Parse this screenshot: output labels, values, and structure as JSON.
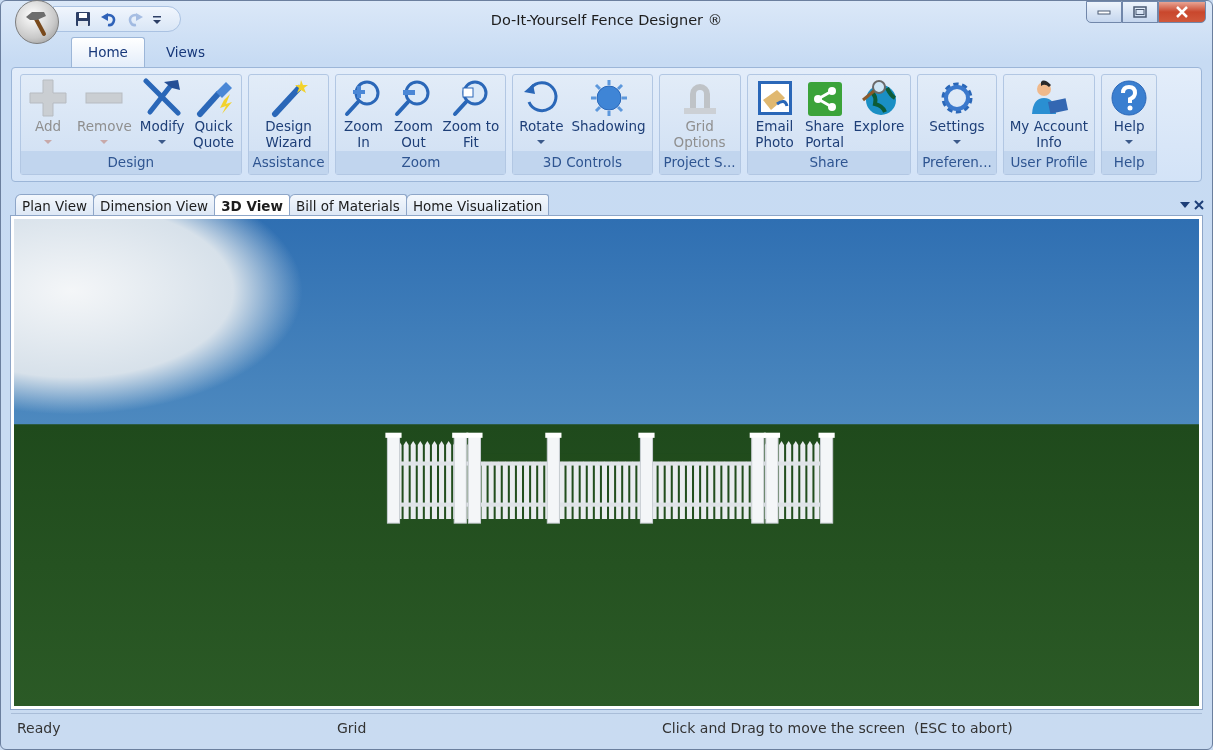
{
  "window": {
    "title": "Do-It-Yourself Fence Designer ®"
  },
  "quick_access": [
    {
      "kind": "save",
      "disabled": false
    },
    {
      "kind": "undo",
      "disabled": false
    },
    {
      "kind": "redo",
      "disabled": true
    },
    {
      "kind": "customize",
      "disabled": false
    }
  ],
  "ribbon_tabs": [
    {
      "label": "Home",
      "selected": true
    },
    {
      "label": "Views",
      "selected": false
    }
  ],
  "ribbon_groups": [
    {
      "label": "Design",
      "buttons": [
        {
          "label": "Add",
          "disabled": true,
          "has_menu": true
        },
        {
          "label": "Remove",
          "disabled": true,
          "has_menu": true
        },
        {
          "label": "Modify",
          "disabled": false,
          "has_menu": true
        },
        {
          "label": "Quick\nQuote",
          "disabled": false,
          "has_menu": false
        }
      ]
    },
    {
      "label": "Assistance",
      "buttons": [
        {
          "label": "Design\nWizard",
          "disabled": false,
          "has_menu": false
        }
      ]
    },
    {
      "label": "Zoom",
      "buttons": [
        {
          "label": "Zoom\nIn",
          "disabled": false,
          "has_menu": false
        },
        {
          "label": "Zoom\nOut",
          "disabled": false,
          "has_menu": false
        },
        {
          "label": "Zoom to\nFit",
          "disabled": false,
          "has_menu": false
        }
      ]
    },
    {
      "label": "3D Controls",
      "buttons": [
        {
          "label": "Rotate",
          "disabled": false,
          "has_menu": true
        },
        {
          "label": "Shadowing",
          "disabled": false,
          "has_menu": false
        }
      ]
    },
    {
      "label": "Project S...",
      "buttons": [
        {
          "label": "Grid\nOptions",
          "disabled": true,
          "has_menu": false
        }
      ]
    },
    {
      "label": "Share",
      "buttons": [
        {
          "label": "Email\nPhoto",
          "disabled": false,
          "has_menu": false
        },
        {
          "label": "Share\nPortal",
          "disabled": false,
          "has_menu": false
        },
        {
          "label": "Explore",
          "disabled": false,
          "has_menu": false
        }
      ]
    },
    {
      "label": "Preferen...",
      "buttons": [
        {
          "label": "Settings",
          "disabled": false,
          "has_menu": true
        }
      ]
    },
    {
      "label": "User Profile",
      "buttons": [
        {
          "label": "My Account\nInfo",
          "disabled": false,
          "has_menu": false
        }
      ]
    },
    {
      "label": "Help",
      "buttons": [
        {
          "label": "Help",
          "disabled": false,
          "has_menu": true
        }
      ]
    }
  ],
  "document_tabs": [
    {
      "label": "Plan View",
      "selected": false
    },
    {
      "label": "Dimension View",
      "selected": false
    },
    {
      "label": "3D View",
      "selected": true
    },
    {
      "label": "Bill of Materials",
      "selected": false
    },
    {
      "label": "Home Visualization",
      "selected": false
    }
  ],
  "status_bar": [
    "Ready",
    "Grid",
    "Click and Drag to move the screen  (ESC to abort)"
  ]
}
